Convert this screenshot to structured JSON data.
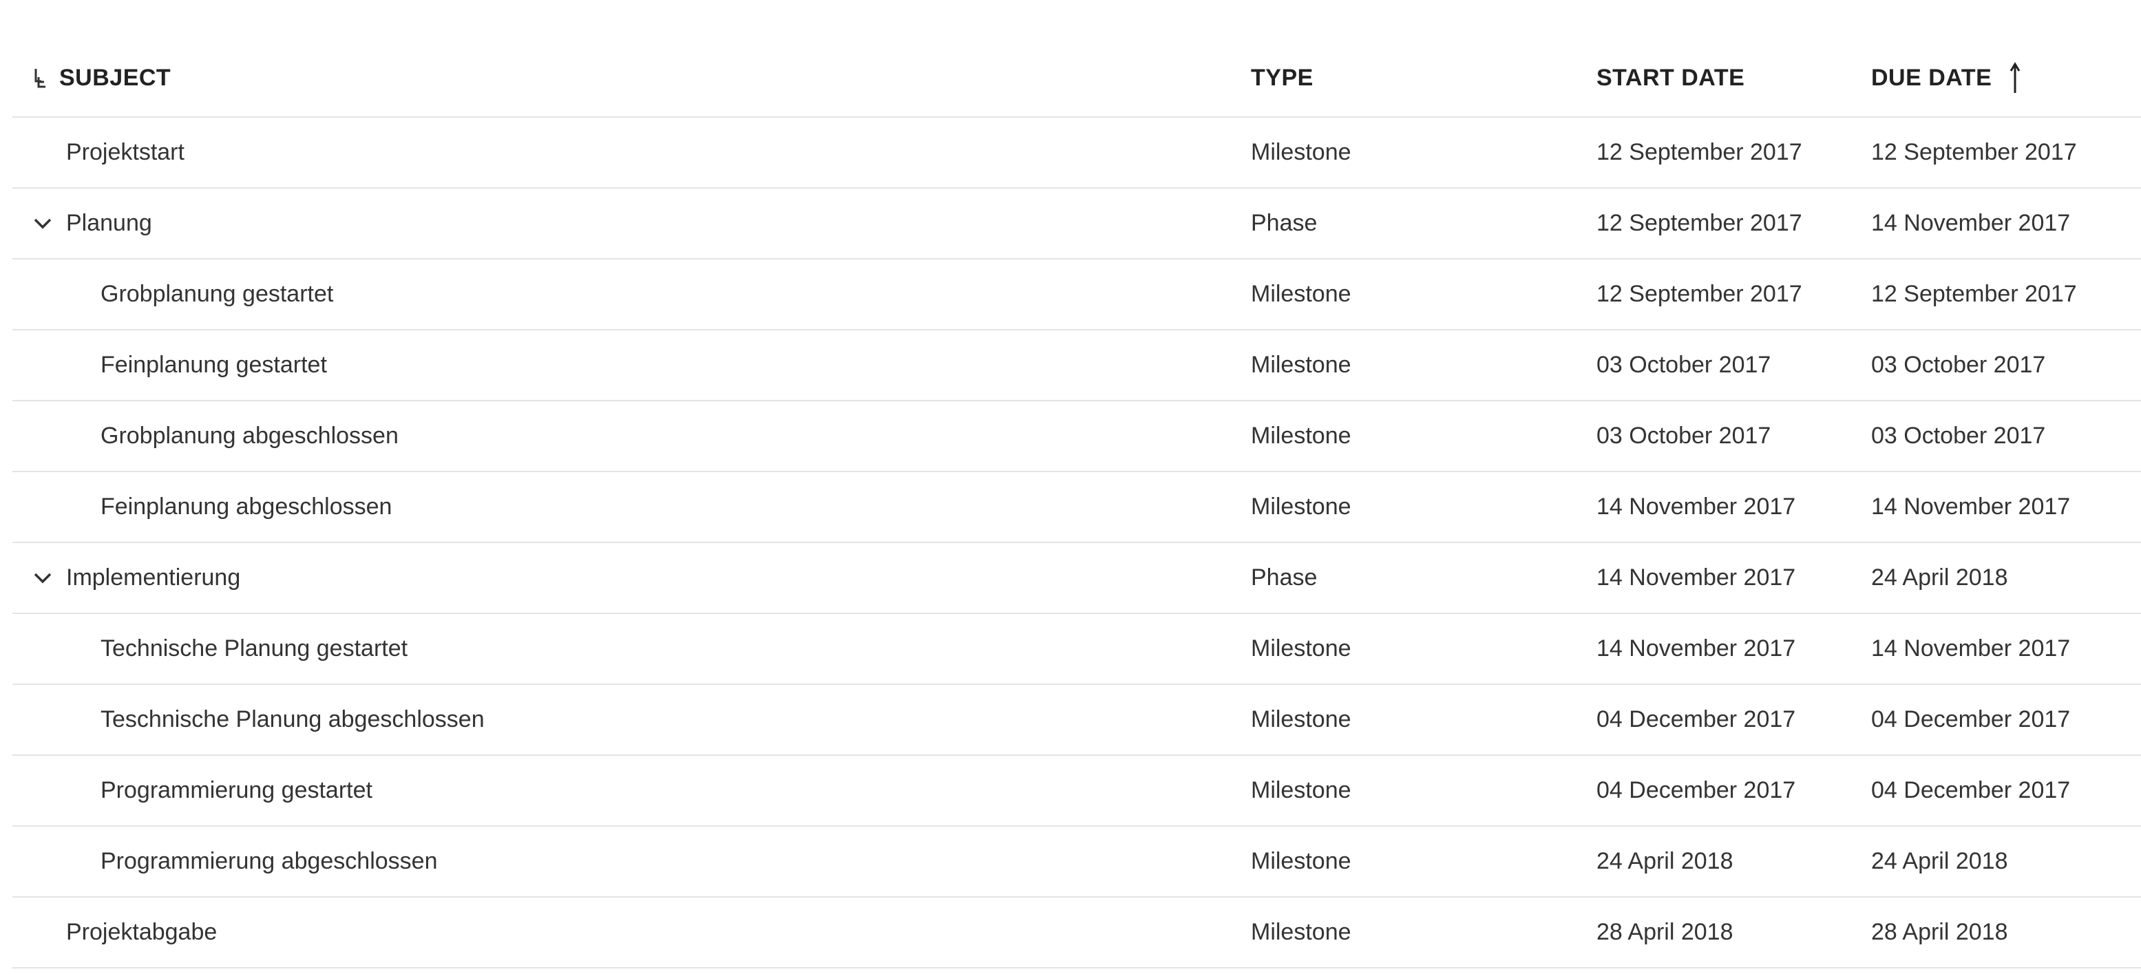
{
  "headers": {
    "subject": "SUBJECT",
    "type": "TYPE",
    "start_date": "START DATE",
    "due_date": "DUE DATE"
  },
  "icons": {
    "hierarchy": "hierarchy-toggle-icon",
    "collapse": "chevron-down-icon",
    "sort": "sort-ascending-arrow-icon"
  },
  "rows": [
    {
      "subject": "Projektstart",
      "type": "Milestone",
      "start": "12 September 2017",
      "due": "12 September 2017"
    },
    {
      "subject": "Planung",
      "type": "Phase",
      "start": "12 September 2017",
      "due": "14 November 2017"
    },
    {
      "subject": "Grobplanung gestartet",
      "type": "Milestone",
      "start": "12 September 2017",
      "due": "12 September 2017"
    },
    {
      "subject": "Feinplanung gestartet",
      "type": "Milestone",
      "start": "03 October 2017",
      "due": "03 October 2017"
    },
    {
      "subject": "Grobplanung abgeschlossen",
      "type": "Milestone",
      "start": "03 October 2017",
      "due": "03 October 2017"
    },
    {
      "subject": "Feinplanung abgeschlossen",
      "type": "Milestone",
      "start": "14 November 2017",
      "due": "14 November 2017"
    },
    {
      "subject": "Implementierung",
      "type": "Phase",
      "start": "14 November 2017",
      "due": "24 April 2018"
    },
    {
      "subject": "Technische Planung gestartet",
      "type": "Milestone",
      "start": "14 November 2017",
      "due": "14 November 2017"
    },
    {
      "subject": "Teschnische Planung abgeschlossen",
      "type": "Milestone",
      "start": "04 December 2017",
      "due": "04 December 2017"
    },
    {
      "subject": "Programmierung gestartet",
      "type": "Milestone",
      "start": "04 December 2017",
      "due": "04 December 2017"
    },
    {
      "subject": "Programmierung abgeschlossen",
      "type": "Milestone",
      "start": "24 April 2018",
      "due": "24 April 2018"
    },
    {
      "subject": "Projektabgabe",
      "type": "Milestone",
      "start": "28 April 2018",
      "due": "28 April 2018"
    }
  ]
}
